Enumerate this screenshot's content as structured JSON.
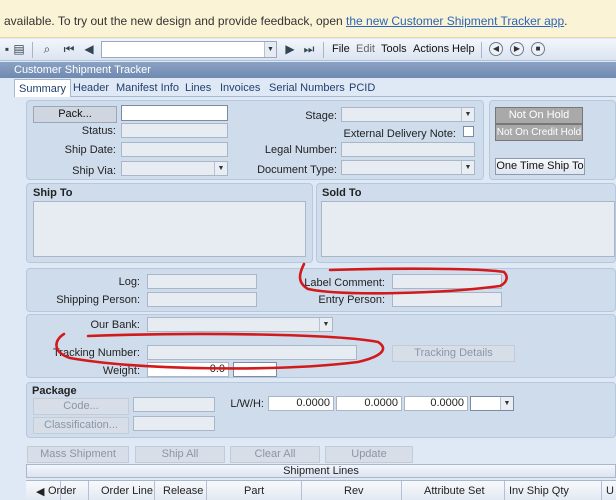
{
  "banner": {
    "text": "available. To try out the new design and provide feedback, open ",
    "link": "the new Customer Shipment Tracker app",
    "tail": "."
  },
  "toolbar": {
    "menus": [
      "File",
      "Edit",
      "Tools",
      "Actions",
      "Help"
    ]
  },
  "window": {
    "title": "Customer Shipment Tracker"
  },
  "tabs": [
    "Summary",
    "Header",
    "Manifest Info",
    "Lines",
    "Invoices",
    "Serial Numbers",
    "PCID"
  ],
  "summary": {
    "pack_button": "Pack...",
    "status_label": "Status:",
    "ship_date_label": "Ship Date:",
    "ship_via_label": "Ship Via:",
    "stage_label": "Stage:",
    "external_delivery_label": "External Delivery Note:",
    "legal_number_label": "Legal Number:",
    "document_type_label": "Document Type:",
    "not_on_hold": "Not On Hold",
    "not_on_credit_hold": "Not On Credit Hold",
    "one_time_ship_to": "One Time Ship To"
  },
  "ship_to": {
    "label": "Ship To"
  },
  "sold_to": {
    "label": "Sold To"
  },
  "shipping": {
    "log_label": "Log:",
    "shipping_person_label": "Shipping Person:",
    "label_comment_label": "Label Comment:",
    "entry_person_label": "Entry Person:"
  },
  "bank": {
    "our_bank_label": "Our Bank:",
    "tracking_number_label": "Tracking Number:",
    "tracking_details_button": "Tracking Details",
    "weight_label": "Weight:",
    "weight_value": "0.0"
  },
  "package": {
    "title": "Package",
    "code_button": "Code...",
    "classification_button": "Classification...",
    "lwh_label": "L/W/H:",
    "length": "0.0000",
    "width": "0.0000",
    "height": "0.0000"
  },
  "actions": [
    "Mass Shipment",
    "Ship All",
    "Clear All",
    "Update"
  ],
  "shipment_lines": {
    "title": "Shipment Lines",
    "columns": [
      "Order",
      "Order Line",
      "Release",
      "Part",
      "Rev",
      "Attribute Set",
      "Inv Ship Qty",
      "U"
    ]
  },
  "colors": {
    "annotation": "#d21a1a",
    "accent": "#2a66b8"
  }
}
